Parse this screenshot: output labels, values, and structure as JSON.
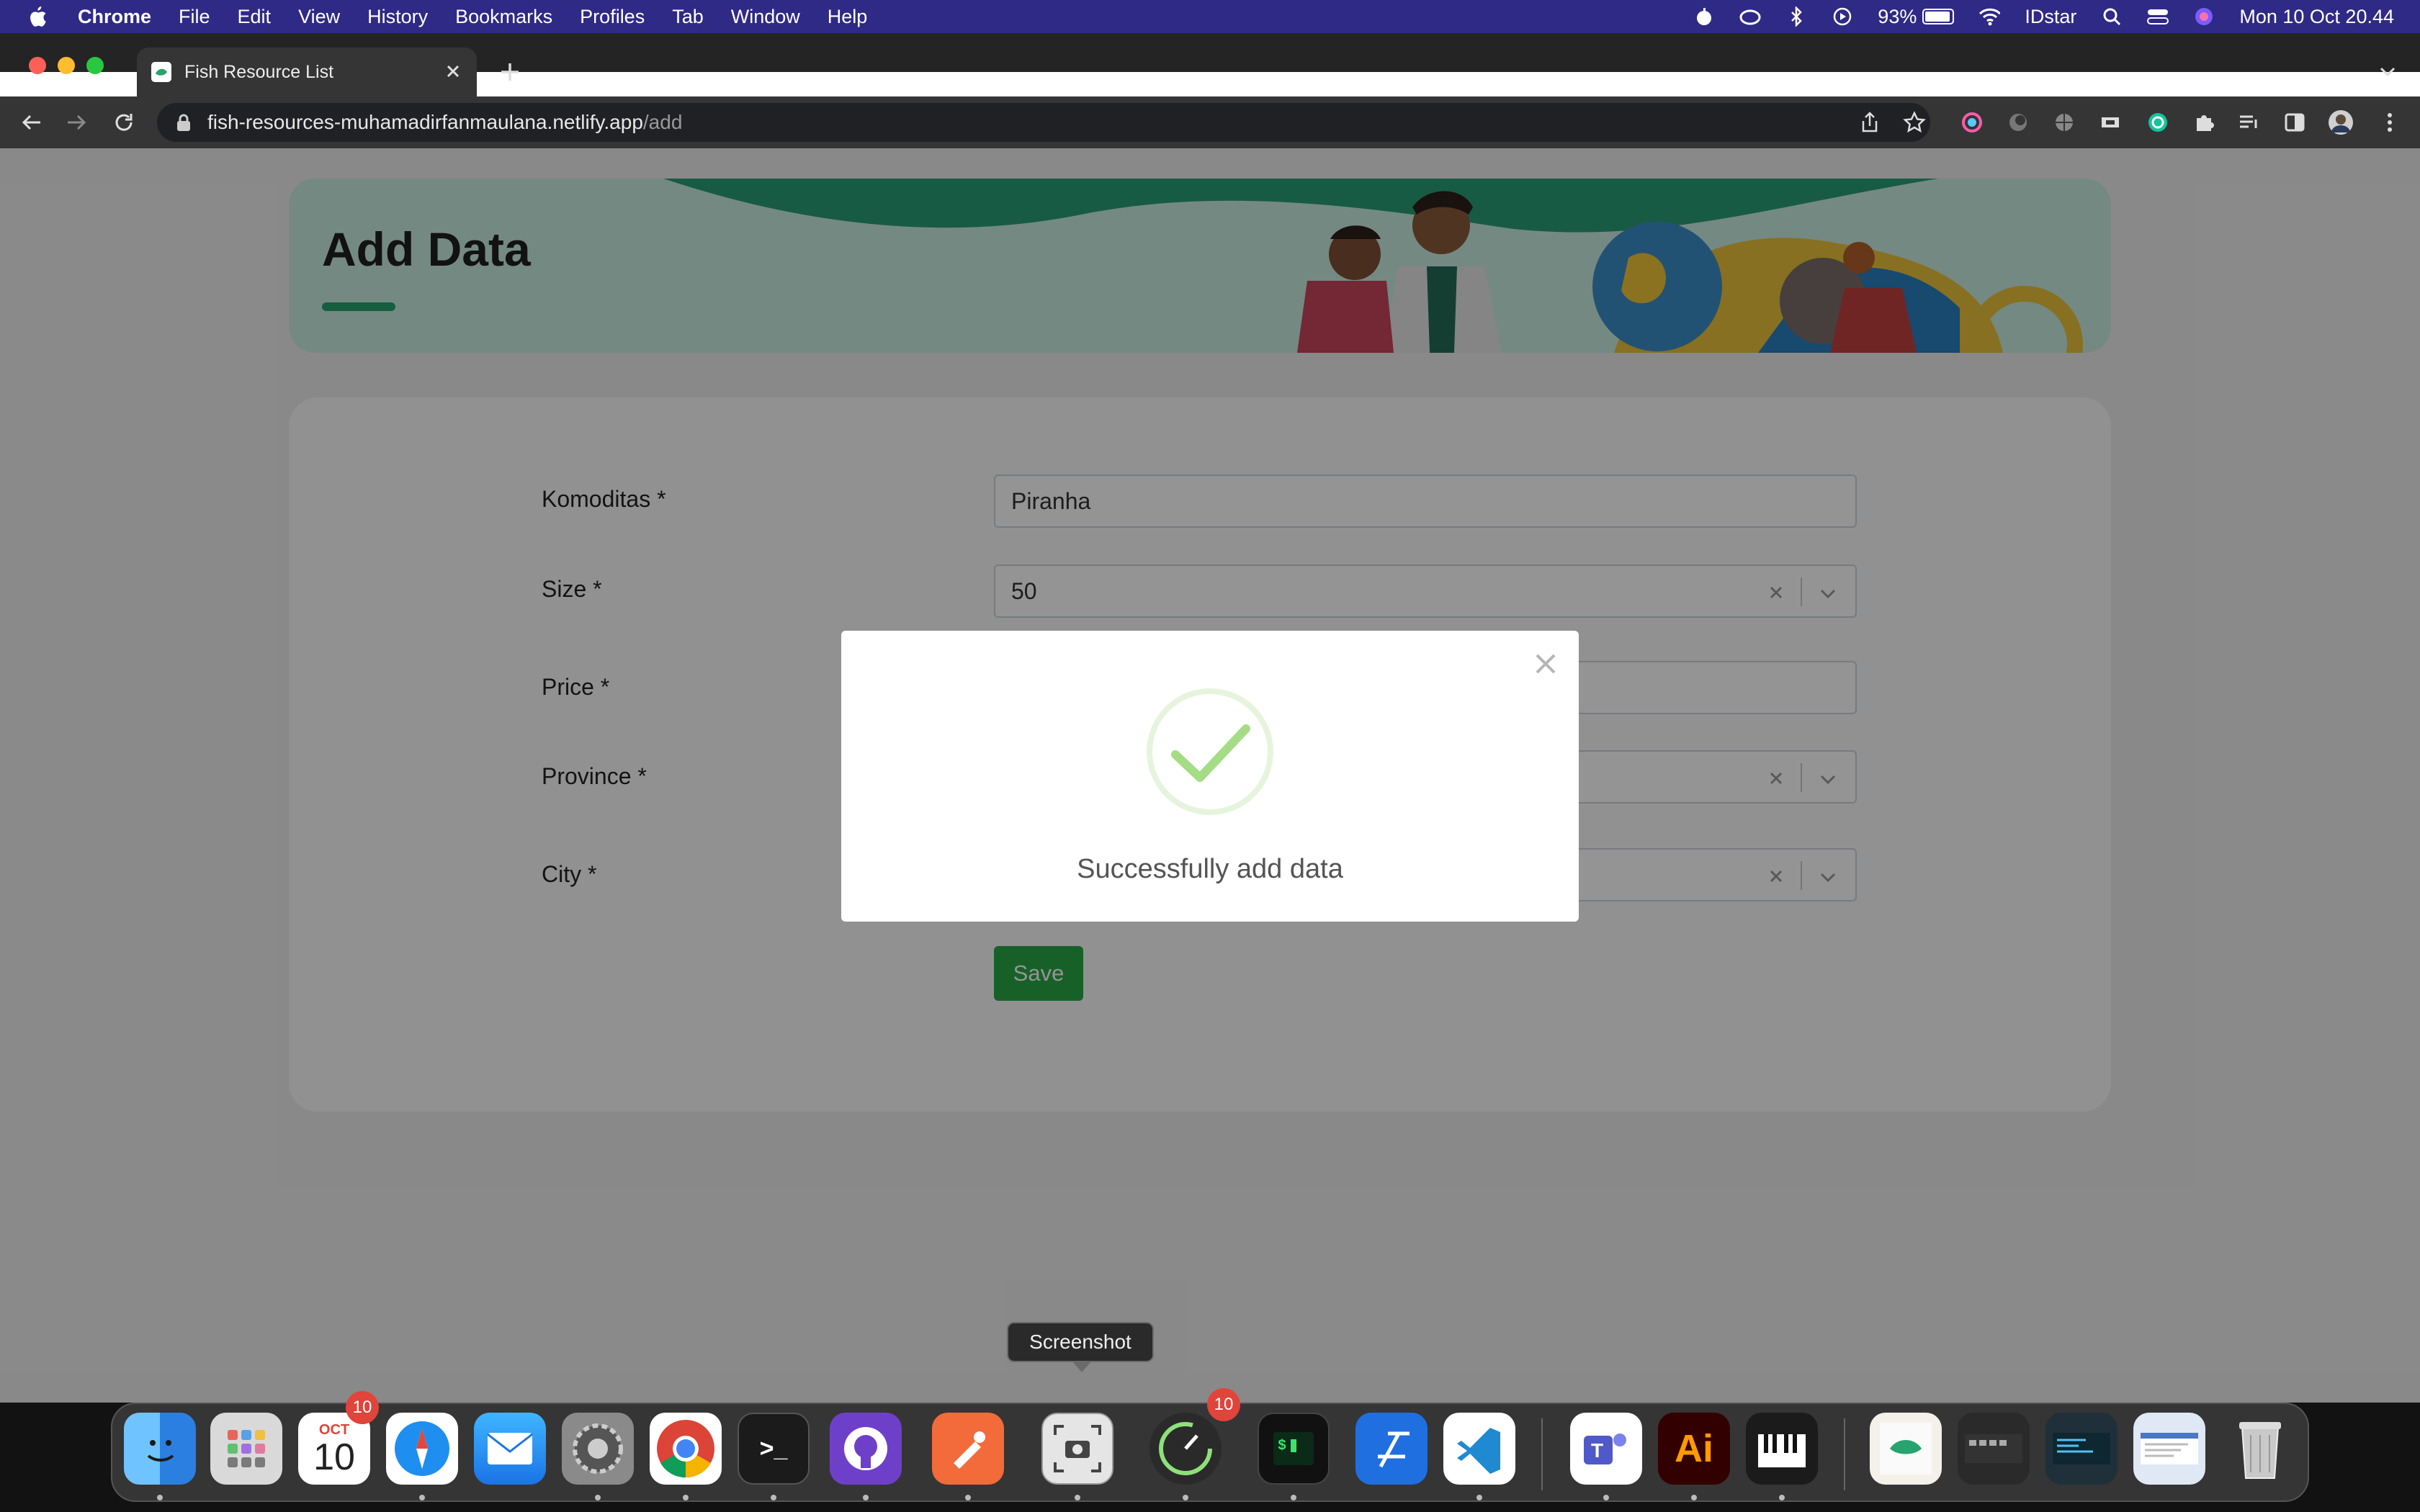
{
  "menubar": {
    "app_name": "Chrome",
    "items": [
      "File",
      "Edit",
      "View",
      "History",
      "Bookmarks",
      "Profiles",
      "Tab",
      "Window",
      "Help"
    ],
    "battery": "93%",
    "user": "IDstar",
    "datetime": "Mon 10 Oct  20.44"
  },
  "browser": {
    "tab_title": "Fish Resource List",
    "url_host": "fish-resources-muhamadirfanmaulana.netlify.app",
    "url_path": "/add"
  },
  "page": {
    "title": "Add Data",
    "accent_color": "#27a36e",
    "form": {
      "komoditas_label": "Komoditas *",
      "komoditas_value": "Piranha",
      "size_label": "Size *",
      "size_value": "50",
      "price_label": "Price *",
      "province_label": "Province *",
      "city_label": "City *",
      "save_label": "Save"
    }
  },
  "modal": {
    "message": "Successfully add data",
    "icon": "success-check-icon",
    "check_color": "#a5dc86"
  },
  "tooltip": {
    "label": "Screenshot"
  },
  "dock": {
    "calendar_month": "OCT",
    "calendar_day": "10",
    "calendar_badge": "10",
    "app_badge": "10",
    "terminal_prompt": ">_",
    "illustrator": "Ai"
  }
}
